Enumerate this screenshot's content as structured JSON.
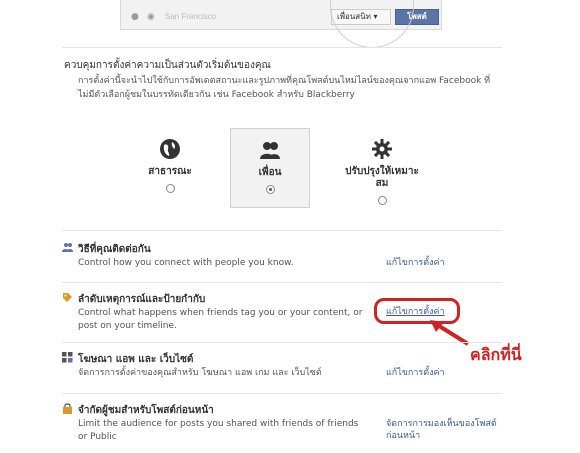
{
  "composer": {
    "location_placeholder": "San Francisco",
    "audience_label": "เพื่อนสนิท ▾",
    "post_label": "โพสต์"
  },
  "default_privacy": {
    "title": "ควบคุมการตั้งค่าความเป็นส่วนตัวเริ่มต้นของคุณ",
    "description": "การตั้งค่านี้จะนำไปใช้กับการอัพเดตสถานะและรูปภาพที่คุณโพสต์บนไหม่ไลน์ของคุณจากแอพ Facebook ที่ไม่มีตัวเลือกผู้ชมในบรรทัดเดียวกัน เช่น Facebook สำหรับ Blackberry",
    "options": [
      {
        "label": "สาธารณะ",
        "icon": "globe-icon",
        "selected": false
      },
      {
        "label": "เพื่อน",
        "icon": "friends-icon",
        "selected": true
      },
      {
        "label": "ปรับปรุงให้เหมาะสม",
        "icon": "gear-icon",
        "selected": false
      }
    ]
  },
  "settings_rows": [
    {
      "title": "วิธีที่คุณติดต่อกัน",
      "description": "Control how you connect with people you know.",
      "edit": "แก้ไขการตั้งค่า",
      "icon": "people-icon"
    },
    {
      "title": "ลำดับเหตุการณ์และป้ายกำกับ",
      "description": "Control what happens when friends tag you or your content, or post on your timeline.",
      "edit": "แก้ไขการตั้งค่า",
      "icon": "tag-icon"
    },
    {
      "title": "โฆษณา แอพ และ เว็บไซต์",
      "description": "จัดการการตั้งค่าของคุณสำหรับ โฆษณา แอพ เกม และ เว็บไซต์",
      "edit": "แก้ไขการตั้งค่า",
      "icon": "apps-icon"
    },
    {
      "title": "จำกัดผู้ชมสำหรับโพสต์ก่อนหน้า",
      "description": "Limit the audience for posts you shared with friends of friends or Public",
      "edit": "จัดการการมองเห็นของโพสต์ก่อนหน้า",
      "icon": "lock-icon"
    }
  ],
  "annotation": {
    "click_here": "คลิกที่นี่",
    "color": "#d32020"
  },
  "colors": {
    "link": "#3b5998",
    "post_button": "#5b74a8"
  }
}
